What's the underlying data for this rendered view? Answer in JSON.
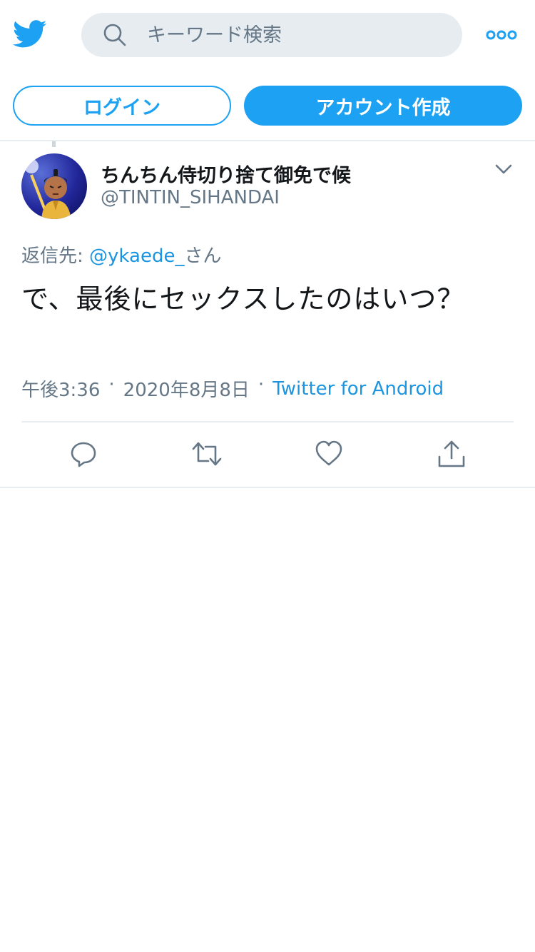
{
  "header": {
    "logo_icon": "twitter-bird-icon",
    "search": {
      "placeholder": "キーワード検索",
      "icon": "search-icon"
    },
    "more_icon": "more-dots-icon",
    "login_label": "ログイン",
    "signup_label": "アカウント作成"
  },
  "tweet": {
    "display_name": "ちんちん侍切り捨て御免で候",
    "screen_name": "@TINTIN_SIHANDAI",
    "reply_prefix": "返信先: ",
    "reply_mention": "@ykaede_",
    "reply_suffix": "さん",
    "text": "で、最後にセックスしたのはいつ？",
    "time": "午後3:36",
    "separator": "·",
    "date": "2020年8月8日",
    "source": "Twitter for Android",
    "actions": [
      "reply-icon",
      "retweet-icon",
      "like-icon",
      "share-icon"
    ]
  },
  "colors": {
    "accent": "#1da1f2",
    "link": "#1b95e0",
    "secondary_text": "#657786",
    "search_bg": "#e6ecf0"
  }
}
